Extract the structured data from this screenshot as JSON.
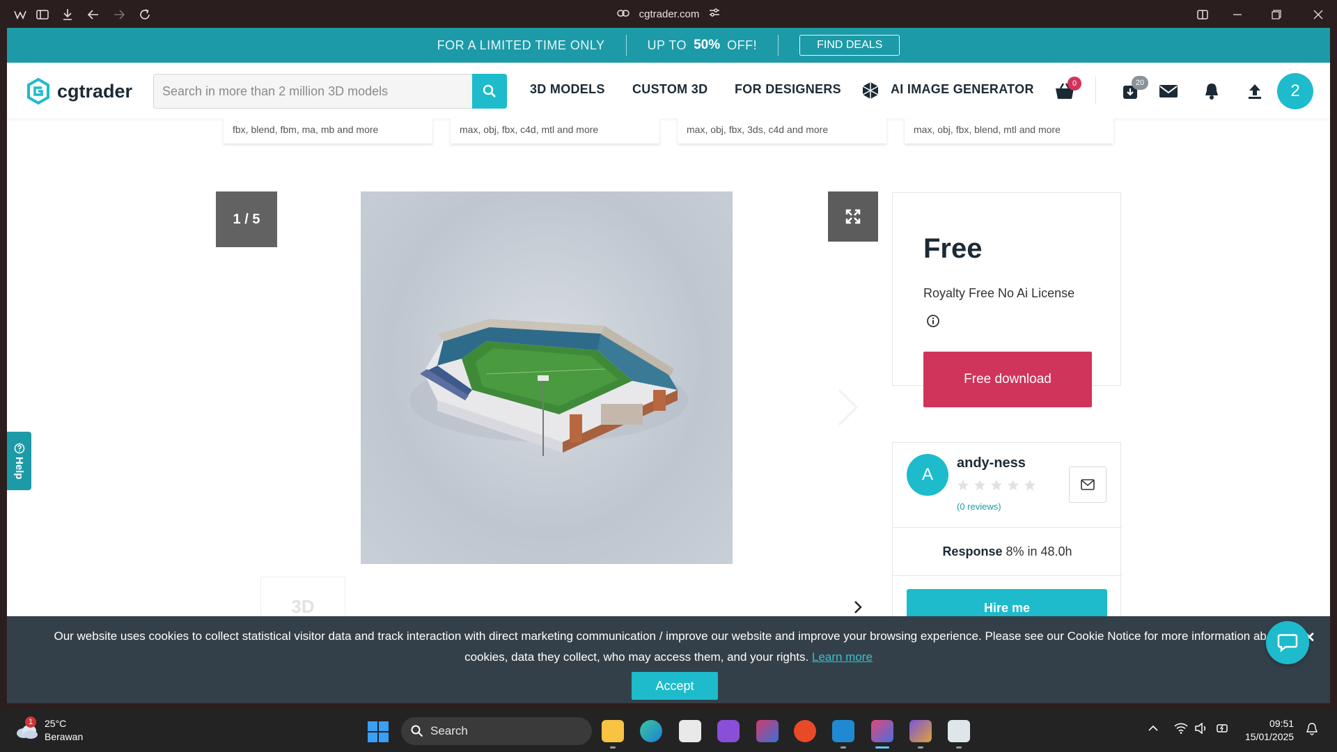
{
  "browser": {
    "url": "cgtrader.com"
  },
  "promo": {
    "limited": "FOR A LIMITED TIME ONLY",
    "upto": "UP TO",
    "percent": "50%",
    "off": "OFF!",
    "deals_button": "FIND DEALS"
  },
  "header": {
    "logo_text": "cgtrader",
    "search_placeholder": "Search in more than 2 million 3D models",
    "nav": [
      "3D MODELS",
      "CUSTOM 3D",
      "FOR DESIGNERS",
      "AI IMAGE GENERATOR"
    ],
    "cart_count": "0",
    "downloads_count": "20",
    "user_initial": "2"
  },
  "related_formats": [
    "fbx, blend, fbm, ma, mb and more",
    "max, obj, fbx, c4d, mtl and more",
    "max, obj, fbx, 3ds, c4d and more",
    "max, obj, fbx, blend, mtl and more"
  ],
  "gallery": {
    "counter": "1 / 5",
    "thumb_label": "3D"
  },
  "pricing": {
    "price": "Free",
    "license": "Royalty Free No Ai License",
    "download_button": "Free download"
  },
  "author": {
    "initial": "A",
    "name": "andy-ness",
    "rating": 0,
    "reviews": "(0 reviews)",
    "response_label": "Response",
    "response_value": "8% in 48.0h",
    "hire_button": "Hire me"
  },
  "help": {
    "label": "Help"
  },
  "cookie": {
    "text": "Our website uses cookies to collect statistical visitor data and track interaction with direct marketing communication / improve our website and improve your browsing experience. Please see our Cookie Notice for more information about cookies, data they collect, who may access them, and your rights.",
    "learn_more": "Learn more",
    "accept": "Accept"
  },
  "taskbar": {
    "weather_temp": "25°C",
    "weather_desc": "Berawan",
    "weather_badge": "1",
    "search_label": "Search",
    "time": "09:51",
    "date": "15/01/2025"
  },
  "colors": {
    "brand_teal": "#1dbbcb",
    "promo_teal": "#1d9aa7",
    "download_red": "#d1345a",
    "cookie_bg": "#344049"
  }
}
